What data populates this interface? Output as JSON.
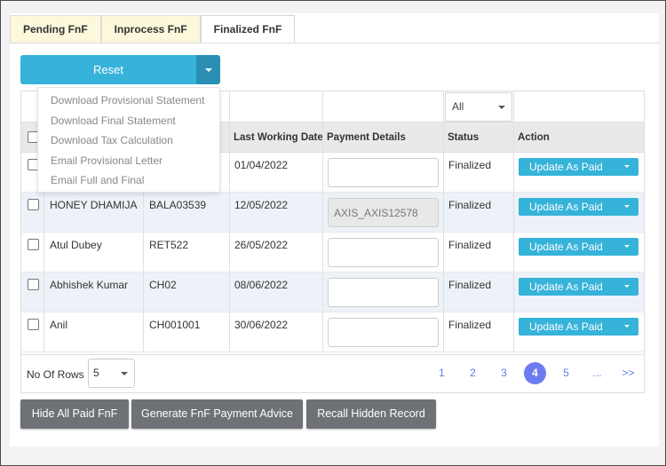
{
  "tabs": [
    {
      "label": "Pending FnF",
      "active": false
    },
    {
      "label": "Inprocess FnF",
      "active": false
    },
    {
      "label": "Finalized FnF",
      "active": true
    }
  ],
  "reset_button": {
    "label": "Reset"
  },
  "reset_menu": {
    "items": [
      "Download Provisional Statement",
      "Download Final Statement",
      "Download Tax Calculation",
      "Email Provisional Letter",
      "Email Full and Final"
    ]
  },
  "filters": {
    "status_value": "All"
  },
  "table": {
    "columns": {
      "last_working_date": "Last Working Date",
      "payment_details": "Payment Details",
      "status": "Status",
      "action": "Action"
    },
    "rows": [
      {
        "name": "",
        "code": "",
        "last_working_date": "01/04/2022",
        "payment": "",
        "payment_disabled": false,
        "status": "Finalized",
        "action": "Update As Paid"
      },
      {
        "name": "HONEY DHAMIJA",
        "code": "BALA03539",
        "last_working_date": "12/05/2022",
        "payment": "AXIS_AXIS12578",
        "payment_disabled": true,
        "status": "Finalized",
        "action": "Update As Paid"
      },
      {
        "name": "Atul Dubey",
        "code": "RET522",
        "last_working_date": "26/05/2022",
        "payment": "",
        "payment_disabled": false,
        "status": "Finalized",
        "action": "Update As Paid"
      },
      {
        "name": "Abhishek Kumar",
        "code": "CH02",
        "last_working_date": "08/06/2022",
        "payment": "",
        "payment_disabled": false,
        "status": "Finalized",
        "action": "Update As Paid"
      },
      {
        "name": "Anil",
        "code": "CH001001",
        "last_working_date": "30/06/2022",
        "payment": "",
        "payment_disabled": false,
        "status": "Finalized",
        "action": "Update As Paid"
      }
    ]
  },
  "footer": {
    "rows_label": "No Of Rows :",
    "rows_value": "5",
    "pages": [
      "1",
      "2",
      "3",
      "4",
      "5",
      "...",
      ">>"
    ],
    "current_page": "4"
  },
  "actions": {
    "hide_paid": "Hide All Paid FnF",
    "generate_advice": "Generate FnF Payment Advice",
    "recall_hidden": "Recall Hidden Record"
  },
  "colors": {
    "primary": "#36b3d9",
    "primary_dark": "#2a8fb3",
    "tab_inactive": "#fbf8dc",
    "row_alt": "#edf1f8",
    "pager_active": "#6d7bf0",
    "bottom_button": "#6e7176"
  }
}
